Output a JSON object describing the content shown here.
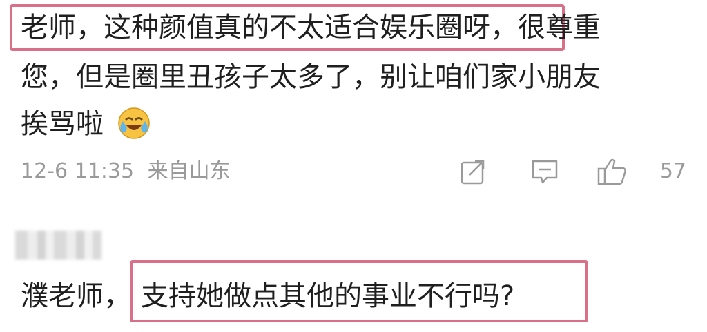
{
  "comment1": {
    "line1_highlight": "老师，这种颜值真的不太适合娱乐圈呀，",
    "line1_rest": "很尊重",
    "line2": "您，但是圈里丑孩子太多了，别让咱们家小朋友",
    "line3": "挨骂啦",
    "emoji": "laugh-cry-emoji",
    "timestamp": "12-6 11:35",
    "location": "来自山东",
    "like_count": "57",
    "icons": [
      "share-icon",
      "comment-icon",
      "like-icon"
    ]
  },
  "comment2": {
    "prefix": "濮老师，",
    "highlight": "支持她做点其他的事业不行吗?"
  },
  "colors": {
    "highlight_border": "#d9708a",
    "meta_text": "#9a9a9a",
    "body_text": "#1f1f1f"
  }
}
